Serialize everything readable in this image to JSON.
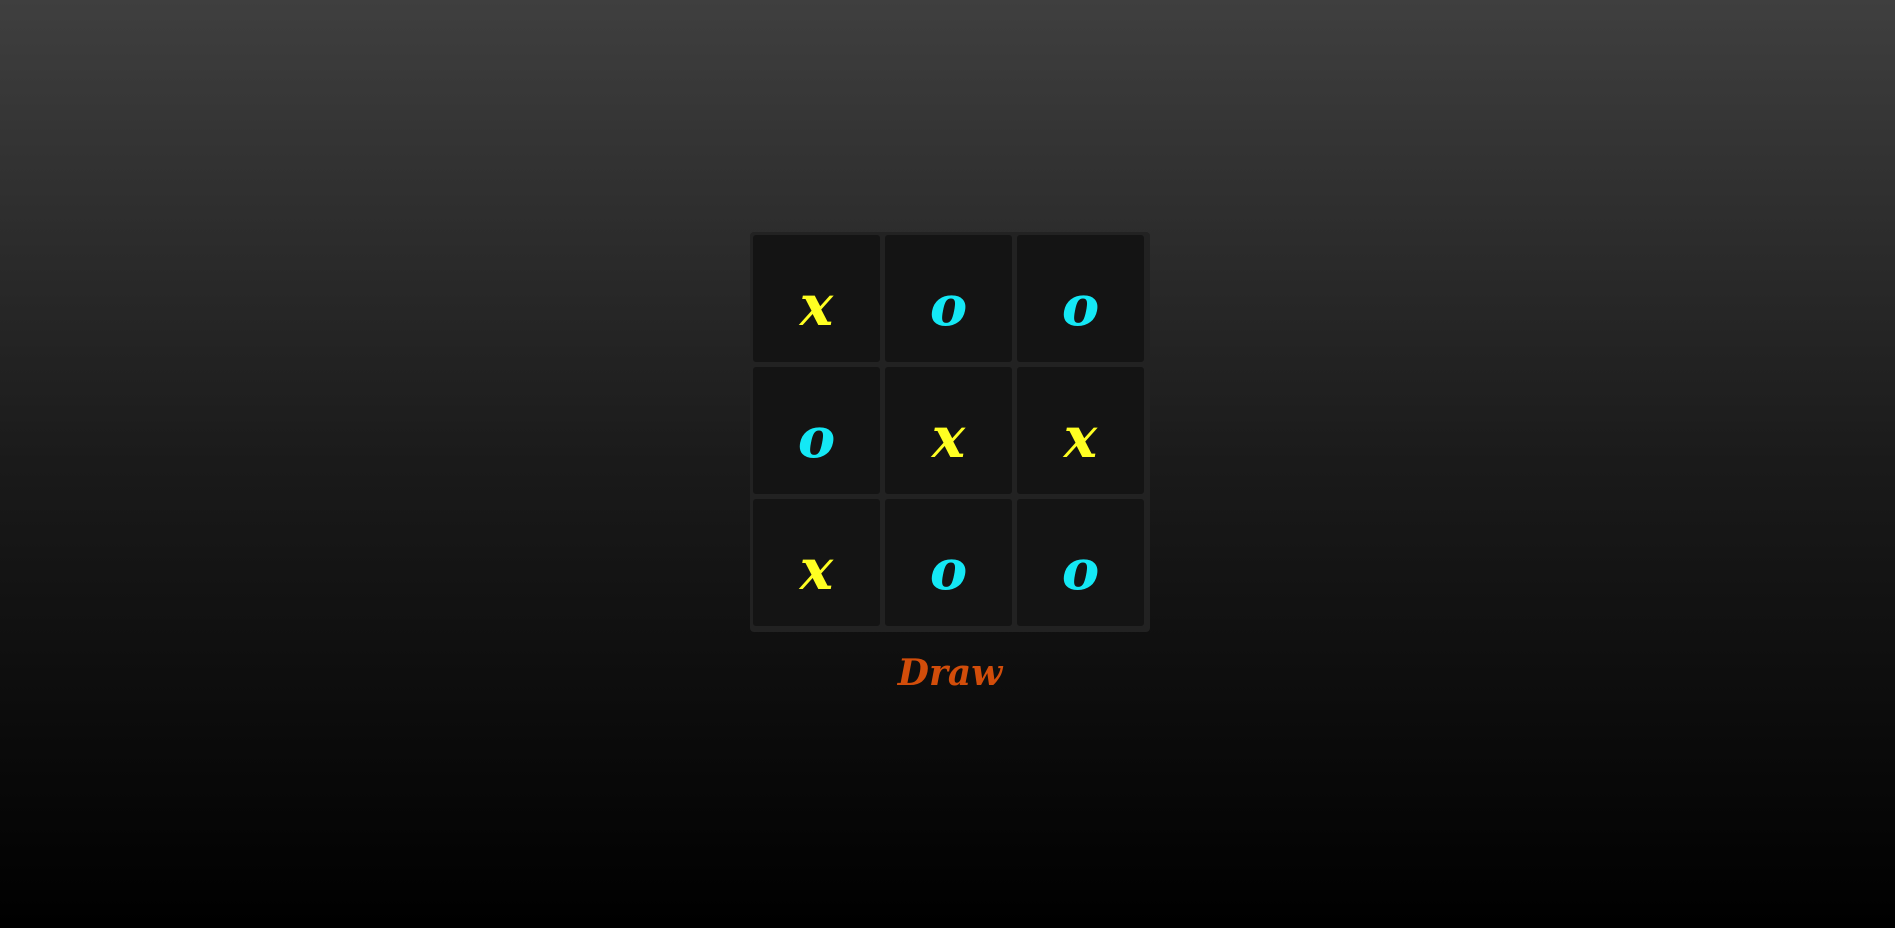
{
  "board": {
    "cells": [
      {
        "mark": "x",
        "player": "x"
      },
      {
        "mark": "o",
        "player": "o"
      },
      {
        "mark": "o",
        "player": "o"
      },
      {
        "mark": "o",
        "player": "o"
      },
      {
        "mark": "x",
        "player": "x"
      },
      {
        "mark": "x",
        "player": "x"
      },
      {
        "mark": "x",
        "player": "x"
      },
      {
        "mark": "o",
        "player": "o"
      },
      {
        "mark": "o",
        "player": "o"
      }
    ]
  },
  "status": {
    "text": "Draw"
  },
  "colors": {
    "x_mark": "#ffff22",
    "o_mark": "#14e8f5",
    "status": "#d24d0a",
    "cell_bg": "#141414",
    "board_bg": "#222222"
  }
}
